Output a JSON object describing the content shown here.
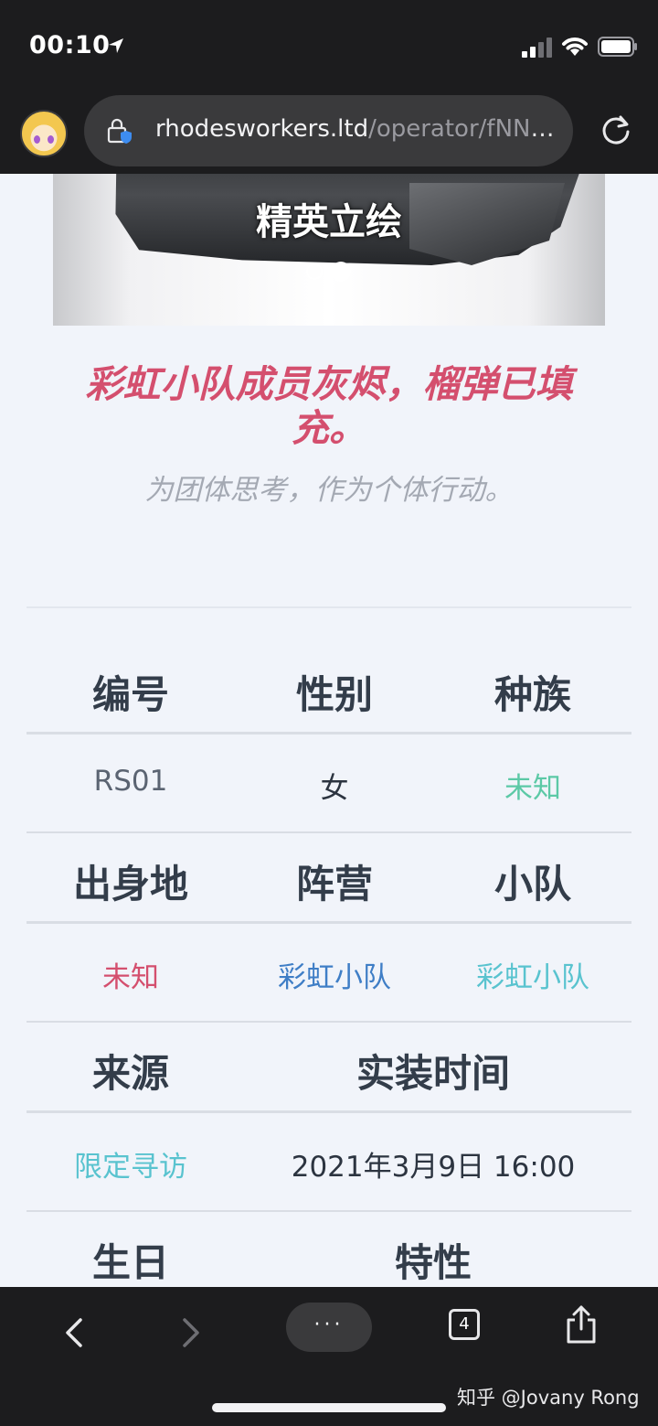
{
  "status_bar": {
    "time": "00:10"
  },
  "browser": {
    "url_domain": "rhodesworkers.ltd",
    "url_path": "/operator/fNN2..."
  },
  "carousel": {
    "caption": "精英立绘",
    "dots": 2,
    "active_dot": 2
  },
  "quote": {
    "main": "彩虹小队成员灰烬，榴弹已填充。",
    "sub": "为团体思考，作为个体行动。"
  },
  "info": {
    "row1_headers": [
      "编号",
      "性别",
      "种族"
    ],
    "row1_values": [
      "RS01",
      "女",
      "未知"
    ],
    "row2_headers": [
      "出身地",
      "阵营",
      "小队"
    ],
    "row2_values": [
      "未知",
      "彩虹小队",
      "彩虹小队"
    ],
    "row3_headers": [
      "来源",
      "实装时间"
    ],
    "row3_values": [
      "限定寻访",
      "2021年3月9日 16:00"
    ],
    "row4_headers": [
      "生日",
      "特性"
    ]
  },
  "colors": {
    "quote_main": "#d44f6e",
    "race_value": "#5cc9a6",
    "origin_value": "#d44f6e",
    "faction_value": "#3f7ec6",
    "squad_value": "#59c3cf",
    "source_value": "#59c3cf"
  },
  "toolbar": {
    "menu_label": "···",
    "tab_count": "4"
  },
  "watermark": "知乎 @Jovany Rong"
}
